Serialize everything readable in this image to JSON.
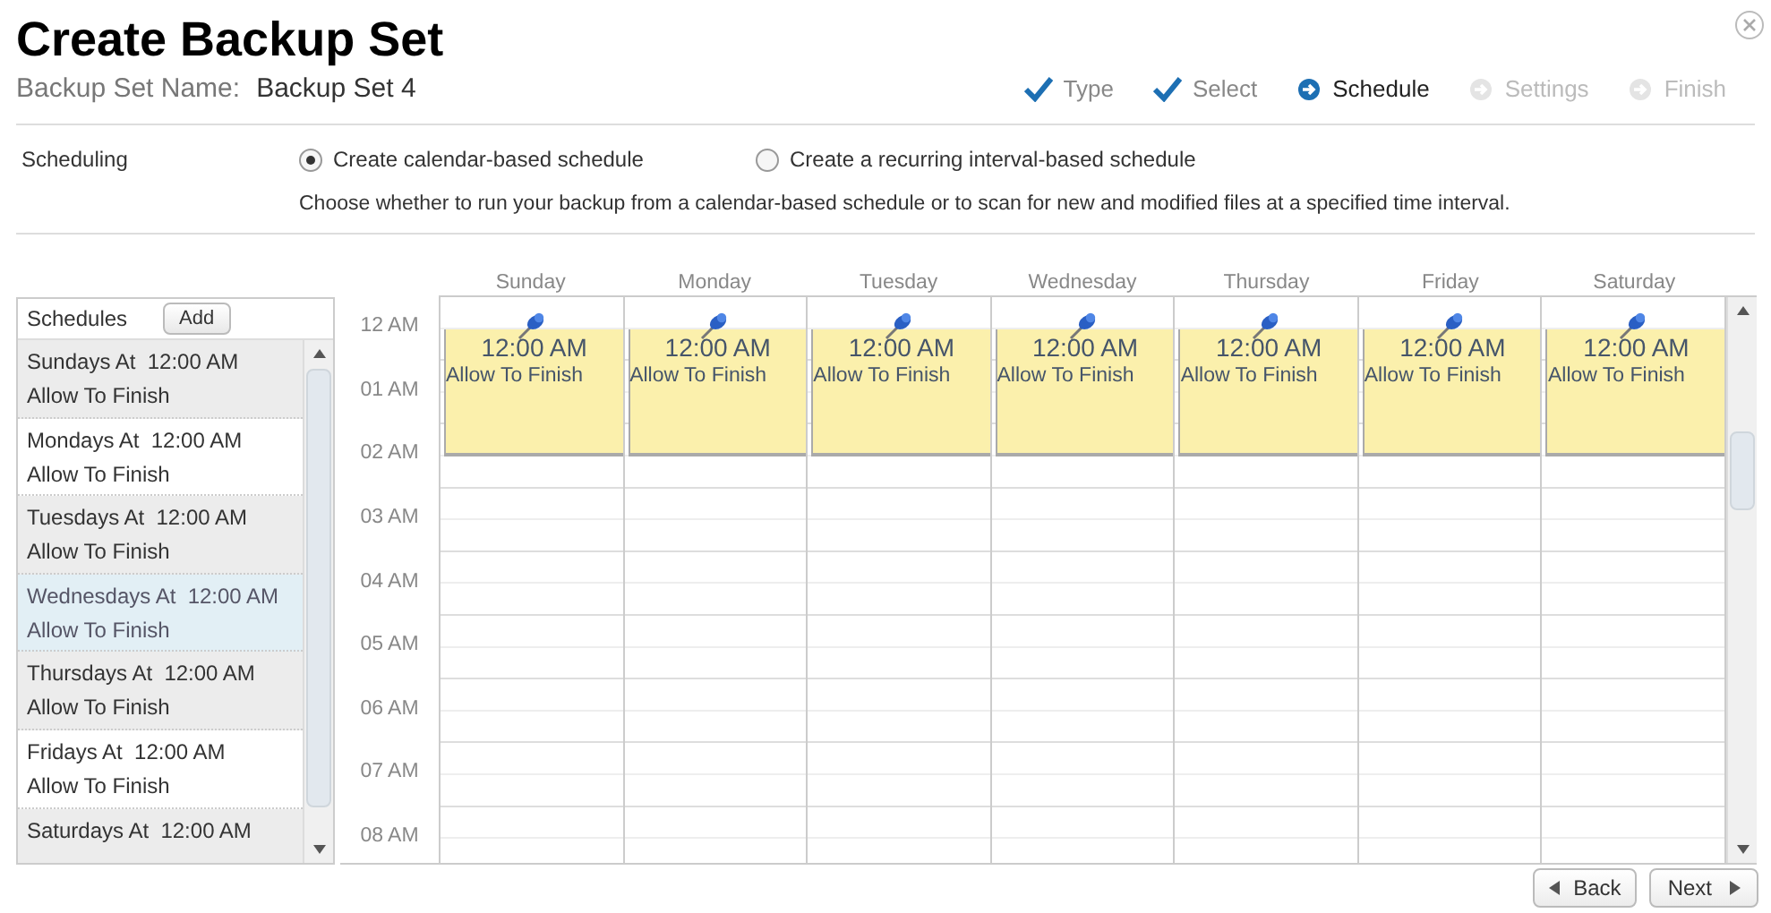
{
  "title": "Create Backup Set",
  "set_name": {
    "label": "Backup Set Name:",
    "value": "Backup Set 4"
  },
  "steps": [
    {
      "label": "Type",
      "completed": true,
      "selected": false
    },
    {
      "label": "Select",
      "completed": true,
      "selected": false
    },
    {
      "label": "Schedule",
      "completed": false,
      "selected": true
    },
    {
      "label": "Settings",
      "completed": false,
      "selected": false
    },
    {
      "label": "Finish",
      "completed": false,
      "selected": false
    }
  ],
  "scheduling": {
    "label": "Scheduling",
    "options": [
      {
        "label": "Create calendar-based schedule",
        "selected": true
      },
      {
        "label": "Create a recurring interval-based schedule",
        "selected": false
      }
    ],
    "description": "Choose whether to run your backup from a calendar-based schedule or to scan for new and modified files at a specified time interval."
  },
  "schedules": {
    "title": "Schedules",
    "add_button": "Add",
    "items": [
      {
        "line1": "Sundays At  12:00 AM",
        "line2": "Allow To Finish",
        "selected": false
      },
      {
        "line1": "Mondays At  12:00 AM",
        "line2": "Allow To Finish",
        "selected": false
      },
      {
        "line1": "Tuesdays At  12:00 AM",
        "line2": "Allow To Finish",
        "selected": false
      },
      {
        "line1": "Wednesdays At  12:00 AM",
        "line2": "Allow To Finish",
        "selected": true
      },
      {
        "line1": "Thursdays At  12:00 AM",
        "line2": "Allow To Finish",
        "selected": false
      },
      {
        "line1": "Fridays At  12:00 AM",
        "line2": "Allow To Finish",
        "selected": false
      },
      {
        "line1": "Saturdays At  12:00 AM",
        "selected": false
      }
    ]
  },
  "calendar": {
    "days": [
      {
        "name": "Sunday",
        "events": [
          {
            "time": "12:00 AM",
            "note": "Allow To Finish"
          }
        ]
      },
      {
        "name": "Monday",
        "events": [
          {
            "time": "12:00 AM",
            "note": "Allow To Finish"
          }
        ]
      },
      {
        "name": "Tuesday",
        "events": [
          {
            "time": "12:00 AM",
            "note": "Allow To Finish"
          }
        ]
      },
      {
        "name": "Wednesday",
        "events": [
          {
            "time": "12:00 AM",
            "note": "Allow To Finish"
          }
        ]
      },
      {
        "name": "Thursday",
        "events": [
          {
            "time": "12:00 AM",
            "note": "Allow To Finish"
          }
        ]
      },
      {
        "name": "Friday",
        "events": [
          {
            "time": "12:00 AM",
            "note": "Allow To Finish"
          }
        ]
      },
      {
        "name": "Saturday",
        "events": [
          {
            "time": "12:00 AM",
            "note": "Allow To Finish"
          }
        ]
      }
    ],
    "hours": [
      "12 AM",
      "01 AM",
      "02 AM",
      "03 AM",
      "04 AM",
      "05 AM",
      "06 AM",
      "07 AM",
      "08 AM"
    ]
  },
  "buttons": {
    "back": "Back",
    "next": "Next"
  }
}
